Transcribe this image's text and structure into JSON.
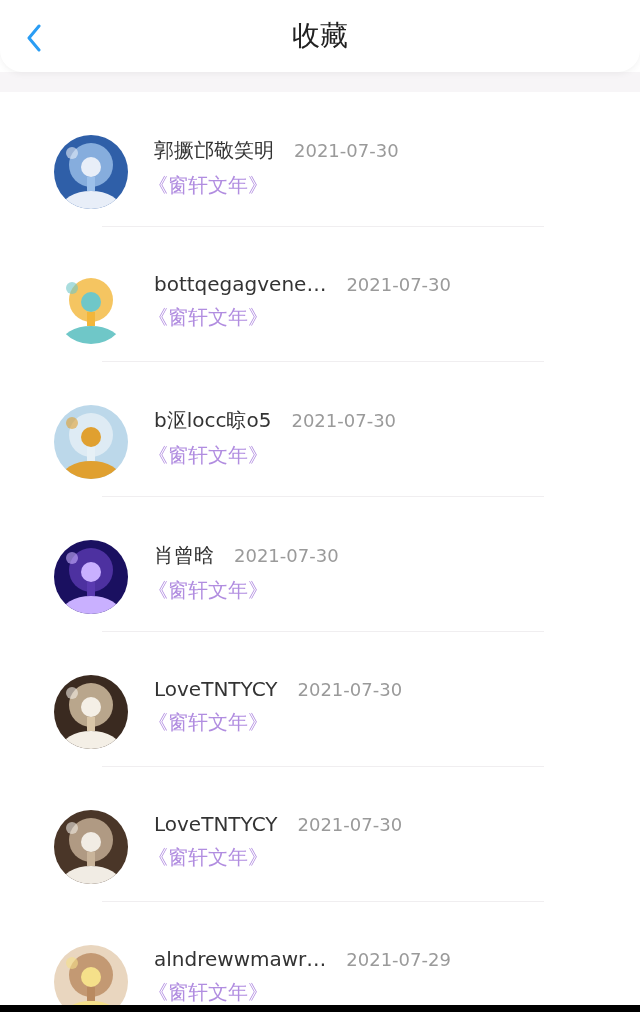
{
  "header": {
    "title": "收藏"
  },
  "items": [
    {
      "name": "郭撅邙敬笑明",
      "date": "2021-07-30",
      "work": "《窗轩文年》"
    },
    {
      "name": "bottqegagvene…",
      "date": "2021-07-30",
      "work": "《窗轩文年》"
    },
    {
      "name": "b沤locc晾o5",
      "date": "2021-07-30",
      "work": "《窗轩文年》"
    },
    {
      "name": "肖曾晗",
      "date": "2021-07-30",
      "work": "《窗轩文年》"
    },
    {
      "name": "LoveTNTYCY",
      "date": "2021-07-30",
      "work": "《窗轩文年》"
    },
    {
      "name": "LoveTNTYCY",
      "date": "2021-07-30",
      "work": "《窗轩文年》"
    },
    {
      "name": "alndrewwmawr…",
      "date": "2021-07-29",
      "work": "《窗轩文年》"
    }
  ]
}
